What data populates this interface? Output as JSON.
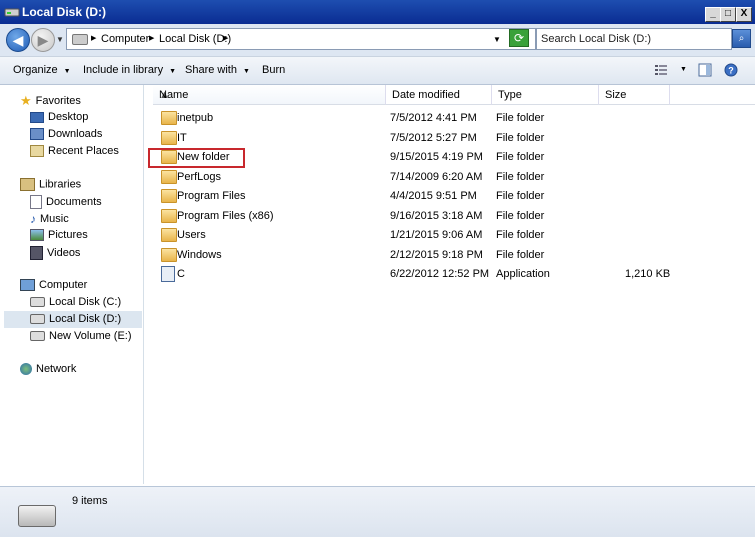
{
  "window": {
    "title": "Local Disk (D:)"
  },
  "title_buttons": {
    "minimize": "_",
    "maximize": "□",
    "close": "X"
  },
  "address": {
    "crumbs": [
      "Computer",
      "Local Disk (D:)"
    ],
    "search_placeholder": "Search Local Disk (D:)"
  },
  "toolbar": {
    "organize": "Organize",
    "include_in_library": "Include in library",
    "share_with": "Share with",
    "burn": "Burn"
  },
  "nav": {
    "favorites": {
      "label": "Favorites",
      "items": [
        "Desktop",
        "Downloads",
        "Recent Places"
      ]
    },
    "libraries": {
      "label": "Libraries",
      "items": [
        "Documents",
        "Music",
        "Pictures",
        "Videos"
      ]
    },
    "computer": {
      "label": "Computer",
      "items": [
        "Local Disk (C:)",
        "Local Disk (D:)",
        "New Volume (E:)"
      ],
      "selected": "Local Disk (D:)"
    },
    "network": {
      "label": "Network"
    }
  },
  "columns": {
    "name": "Name",
    "date_modified": "Date modified",
    "type": "Type",
    "size": "Size"
  },
  "files": [
    {
      "name": "inetpub",
      "date": "7/5/2012 4:41 PM",
      "type": "File folder",
      "size": "",
      "icon": "folder-icon"
    },
    {
      "name": "IT",
      "date": "7/5/2012 5:27 PM",
      "type": "File folder",
      "size": "",
      "icon": "folder-icon"
    },
    {
      "name": "New folder",
      "date": "9/15/2015 4:19 PM",
      "type": "File folder",
      "size": "",
      "icon": "folder-icon"
    },
    {
      "name": "PerfLogs",
      "date": "7/14/2009 6:20 AM",
      "type": "File folder",
      "size": "",
      "icon": "folder-icon"
    },
    {
      "name": "Program Files",
      "date": "4/4/2015 9:51 PM",
      "type": "File folder",
      "size": "",
      "icon": "folder-icon"
    },
    {
      "name": "Program Files (x86)",
      "date": "9/16/2015 3:18 AM",
      "type": "File folder",
      "size": "",
      "icon": "folder-icon"
    },
    {
      "name": "Users",
      "date": "1/21/2015 9:06 AM",
      "type": "File folder",
      "size": "",
      "icon": "folder-icon"
    },
    {
      "name": "Windows",
      "date": "2/12/2015 9:18 PM",
      "type": "File folder",
      "size": "",
      "icon": "folder-icon"
    },
    {
      "name": "C",
      "date": "6/22/2012 12:52 PM",
      "type": "Application",
      "size": "1,210 KB",
      "icon": "application-icon"
    }
  ],
  "status": {
    "item_count": "9 items"
  },
  "colors": {
    "titlebar": "#0a2c92",
    "highlight": "#c8282d",
    "selected_nav": "#dce6f0"
  }
}
